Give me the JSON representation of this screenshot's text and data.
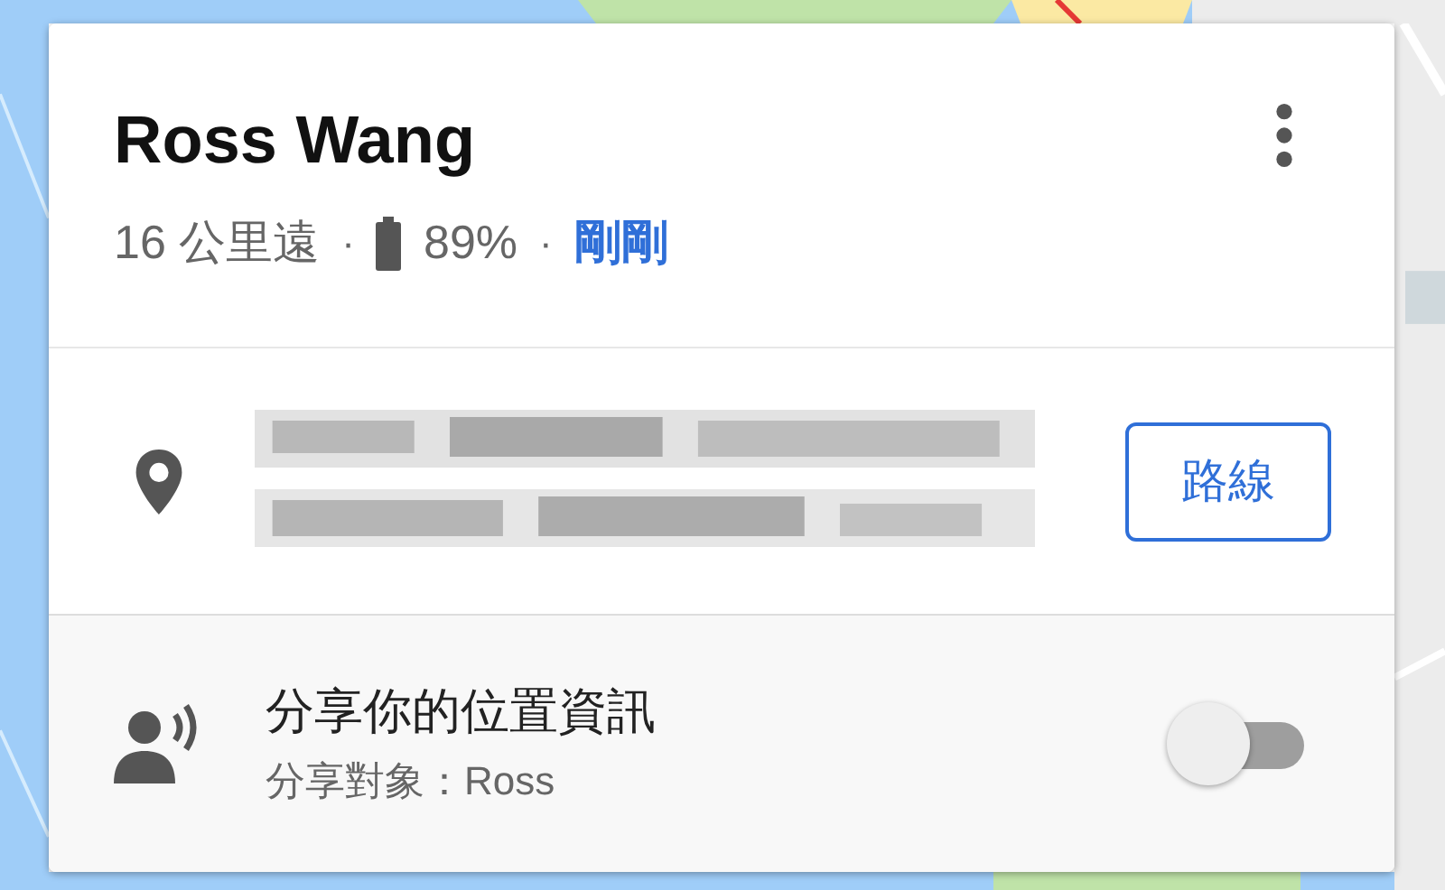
{
  "person": {
    "name": "Ross Wang",
    "distance": "16 公里遠",
    "separator_1": "·",
    "battery": "89%",
    "separator_2": "·",
    "updated": "剛剛"
  },
  "address": {
    "kind": "picture",
    "directions_button": "路線"
  },
  "sharing": {
    "title": "分享你的位置資訊",
    "subtitle": "分享對象：Ross",
    "on": false
  }
}
